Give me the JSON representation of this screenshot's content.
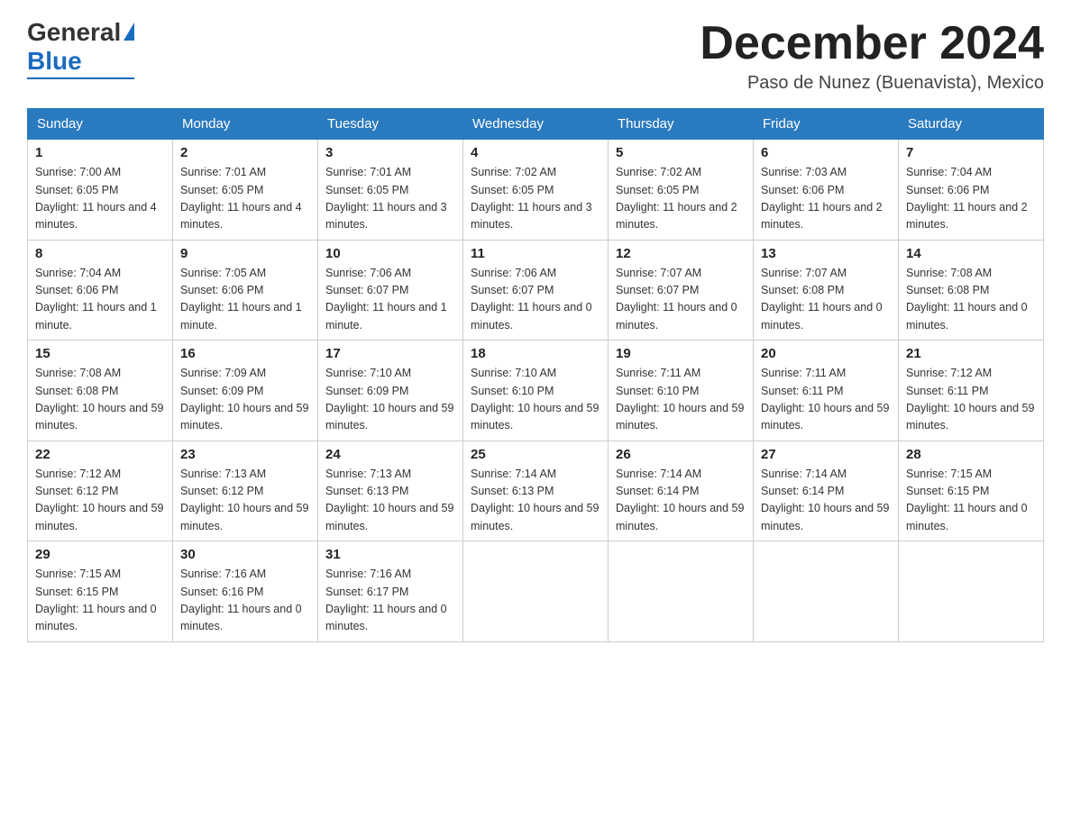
{
  "logo": {
    "general": "General",
    "blue": "Blue"
  },
  "header": {
    "month_year": "December 2024",
    "location": "Paso de Nunez (Buenavista), Mexico"
  },
  "days_of_week": [
    "Sunday",
    "Monday",
    "Tuesday",
    "Wednesday",
    "Thursday",
    "Friday",
    "Saturday"
  ],
  "weeks": [
    [
      {
        "day": "1",
        "sunrise": "7:00 AM",
        "sunset": "6:05 PM",
        "daylight": "11 hours and 4 minutes."
      },
      {
        "day": "2",
        "sunrise": "7:01 AM",
        "sunset": "6:05 PM",
        "daylight": "11 hours and 4 minutes."
      },
      {
        "day": "3",
        "sunrise": "7:01 AM",
        "sunset": "6:05 PM",
        "daylight": "11 hours and 3 minutes."
      },
      {
        "day": "4",
        "sunrise": "7:02 AM",
        "sunset": "6:05 PM",
        "daylight": "11 hours and 3 minutes."
      },
      {
        "day": "5",
        "sunrise": "7:02 AM",
        "sunset": "6:05 PM",
        "daylight": "11 hours and 2 minutes."
      },
      {
        "day": "6",
        "sunrise": "7:03 AM",
        "sunset": "6:06 PM",
        "daylight": "11 hours and 2 minutes."
      },
      {
        "day": "7",
        "sunrise": "7:04 AM",
        "sunset": "6:06 PM",
        "daylight": "11 hours and 2 minutes."
      }
    ],
    [
      {
        "day": "8",
        "sunrise": "7:04 AM",
        "sunset": "6:06 PM",
        "daylight": "11 hours and 1 minute."
      },
      {
        "day": "9",
        "sunrise": "7:05 AM",
        "sunset": "6:06 PM",
        "daylight": "11 hours and 1 minute."
      },
      {
        "day": "10",
        "sunrise": "7:06 AM",
        "sunset": "6:07 PM",
        "daylight": "11 hours and 1 minute."
      },
      {
        "day": "11",
        "sunrise": "7:06 AM",
        "sunset": "6:07 PM",
        "daylight": "11 hours and 0 minutes."
      },
      {
        "day": "12",
        "sunrise": "7:07 AM",
        "sunset": "6:07 PM",
        "daylight": "11 hours and 0 minutes."
      },
      {
        "day": "13",
        "sunrise": "7:07 AM",
        "sunset": "6:08 PM",
        "daylight": "11 hours and 0 minutes."
      },
      {
        "day": "14",
        "sunrise": "7:08 AM",
        "sunset": "6:08 PM",
        "daylight": "11 hours and 0 minutes."
      }
    ],
    [
      {
        "day": "15",
        "sunrise": "7:08 AM",
        "sunset": "6:08 PM",
        "daylight": "10 hours and 59 minutes."
      },
      {
        "day": "16",
        "sunrise": "7:09 AM",
        "sunset": "6:09 PM",
        "daylight": "10 hours and 59 minutes."
      },
      {
        "day": "17",
        "sunrise": "7:10 AM",
        "sunset": "6:09 PM",
        "daylight": "10 hours and 59 minutes."
      },
      {
        "day": "18",
        "sunrise": "7:10 AM",
        "sunset": "6:10 PM",
        "daylight": "10 hours and 59 minutes."
      },
      {
        "day": "19",
        "sunrise": "7:11 AM",
        "sunset": "6:10 PM",
        "daylight": "10 hours and 59 minutes."
      },
      {
        "day": "20",
        "sunrise": "7:11 AM",
        "sunset": "6:11 PM",
        "daylight": "10 hours and 59 minutes."
      },
      {
        "day": "21",
        "sunrise": "7:12 AM",
        "sunset": "6:11 PM",
        "daylight": "10 hours and 59 minutes."
      }
    ],
    [
      {
        "day": "22",
        "sunrise": "7:12 AM",
        "sunset": "6:12 PM",
        "daylight": "10 hours and 59 minutes."
      },
      {
        "day": "23",
        "sunrise": "7:13 AM",
        "sunset": "6:12 PM",
        "daylight": "10 hours and 59 minutes."
      },
      {
        "day": "24",
        "sunrise": "7:13 AM",
        "sunset": "6:13 PM",
        "daylight": "10 hours and 59 minutes."
      },
      {
        "day": "25",
        "sunrise": "7:14 AM",
        "sunset": "6:13 PM",
        "daylight": "10 hours and 59 minutes."
      },
      {
        "day": "26",
        "sunrise": "7:14 AM",
        "sunset": "6:14 PM",
        "daylight": "10 hours and 59 minutes."
      },
      {
        "day": "27",
        "sunrise": "7:14 AM",
        "sunset": "6:14 PM",
        "daylight": "10 hours and 59 minutes."
      },
      {
        "day": "28",
        "sunrise": "7:15 AM",
        "sunset": "6:15 PM",
        "daylight": "11 hours and 0 minutes."
      }
    ],
    [
      {
        "day": "29",
        "sunrise": "7:15 AM",
        "sunset": "6:15 PM",
        "daylight": "11 hours and 0 minutes."
      },
      {
        "day": "30",
        "sunrise": "7:16 AM",
        "sunset": "6:16 PM",
        "daylight": "11 hours and 0 minutes."
      },
      {
        "day": "31",
        "sunrise": "7:16 AM",
        "sunset": "6:17 PM",
        "daylight": "11 hours and 0 minutes."
      },
      null,
      null,
      null,
      null
    ]
  ]
}
